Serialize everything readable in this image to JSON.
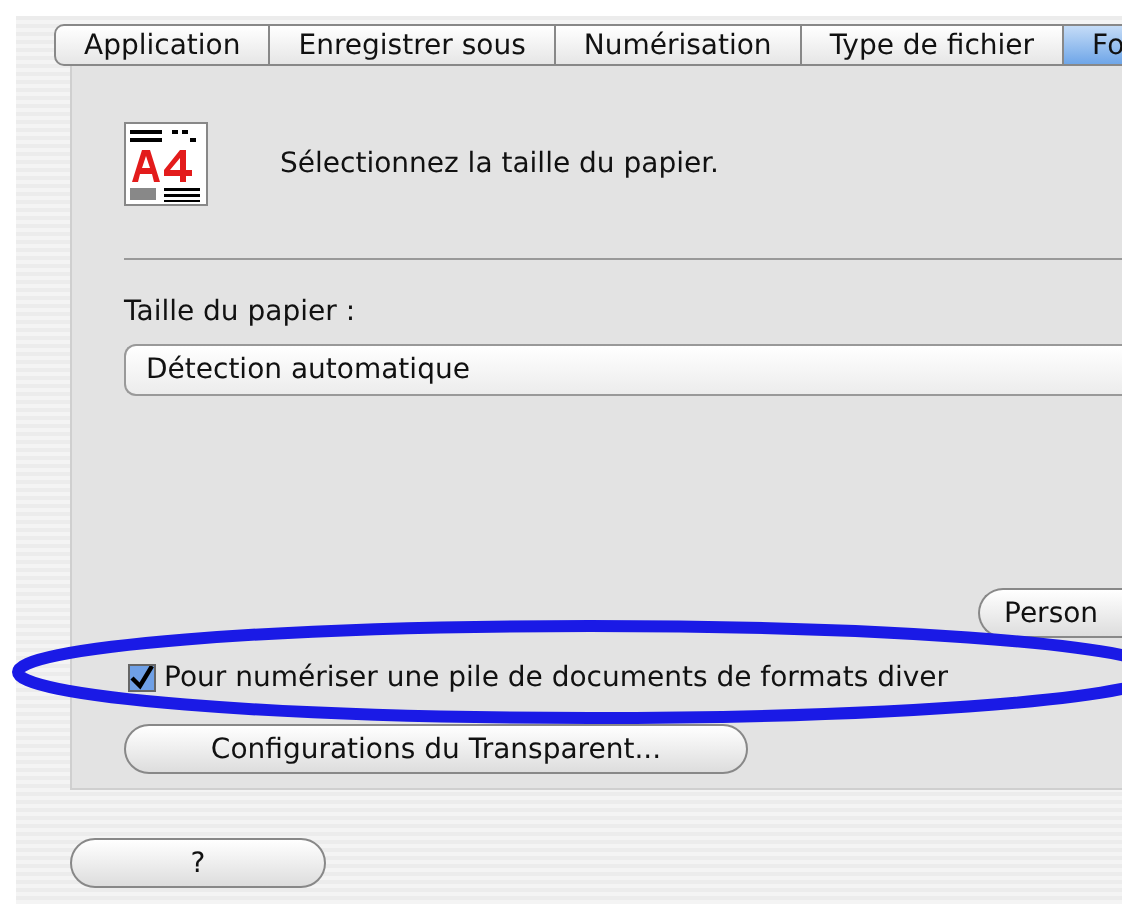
{
  "tabs": [
    {
      "label": "Application",
      "selected": false
    },
    {
      "label": "Enregistrer sous",
      "selected": false
    },
    {
      "label": "Numérisation",
      "selected": false
    },
    {
      "label": "Type de fichier",
      "selected": false
    },
    {
      "label": "Fo",
      "selected": true
    }
  ],
  "header": {
    "text": "Sélectionnez la taille du papier."
  },
  "paper_size": {
    "label": "Taille du papier :",
    "value": "Détection automatique"
  },
  "custom_button": "Person",
  "mixed_sizes": {
    "label": "Pour numériser une pile de documents de formats diver",
    "checked": true
  },
  "transparency_button": "Configurations du Transparent...",
  "help_button": "?"
}
